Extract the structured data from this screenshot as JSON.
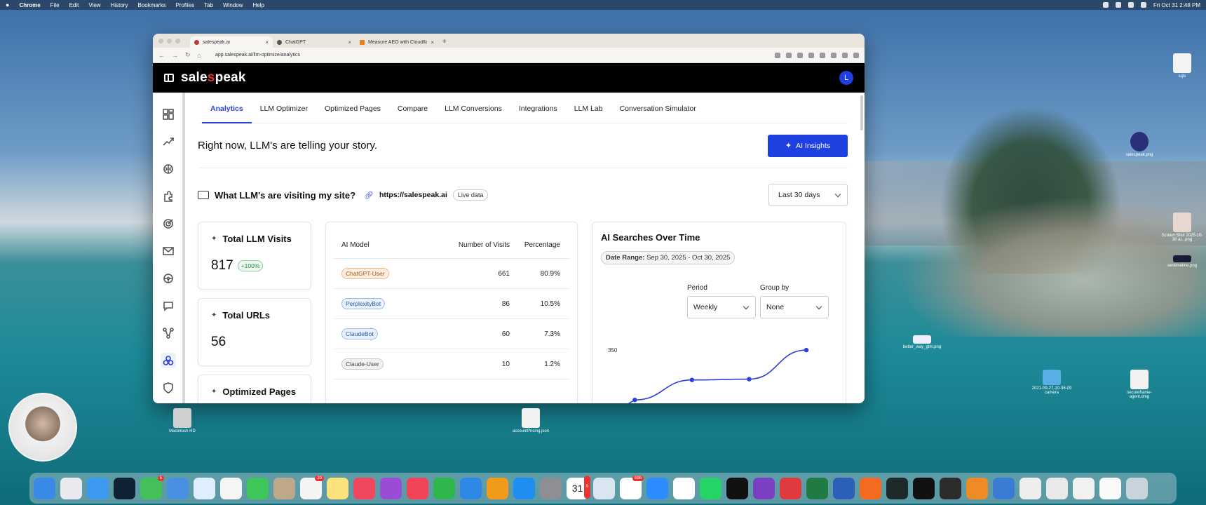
{
  "menubar": {
    "app": "Chrome",
    "items": [
      "File",
      "Edit",
      "View",
      "History",
      "Bookmarks",
      "Profiles",
      "Tab",
      "Window",
      "Help"
    ],
    "clock": "Fri Oct 31  2:48 PM"
  },
  "browser": {
    "tabs": [
      {
        "label": "salespeak.ai",
        "active": true
      },
      {
        "label": "ChatGPT",
        "active": false
      },
      {
        "label": "Measure AEO with Cloudfla…",
        "active": false
      }
    ],
    "url": "app.salespeak.ai/llm-optimize/analytics"
  },
  "app": {
    "logo_prefix": "sale",
    "logo_dot": "s",
    "logo_suffix": "peak",
    "avatar_letter": "L",
    "nav_icons": [
      "dashboard-icon",
      "trend-icon",
      "brain-icon",
      "puzzle-icon",
      "target-icon",
      "mail-icon",
      "steering-icon",
      "chat-icon",
      "network-icon",
      "llm-icon",
      "shield-icon"
    ],
    "tabs": [
      "Analytics",
      "LLM Optimizer",
      "Optimized Pages",
      "Compare",
      "LLM Conversions",
      "Integrations",
      "LLM Lab",
      "Conversation Simulator"
    ],
    "active_tab": "Analytics",
    "hero_title": "Right now, LLM's are telling your story.",
    "ai_insights_label": "AI Insights",
    "visit_question": "What LLM's are visiting my site?",
    "site_url": "https://salespeak.ai",
    "live_badge": "Live data",
    "date_range_select": "Last 30 days",
    "stats": [
      {
        "title": "Total LLM Visits",
        "value": "817",
        "badge": "+100%"
      },
      {
        "title": "Total URLs",
        "value": "56",
        "badge": ""
      },
      {
        "title": "Optimized Pages",
        "value": "",
        "badge": ""
      }
    ],
    "table": {
      "headers": [
        "AI Model",
        "Number of Visits",
        "Percentage"
      ],
      "rows": [
        {
          "model": "ChatGPT-User",
          "visits": "661",
          "pct": "80.9%",
          "color": "orange"
        },
        {
          "model": "PerplexityBot",
          "visits": "86",
          "pct": "10.5%",
          "color": "blue"
        },
        {
          "model": "ClaudeBot",
          "visits": "60",
          "pct": "7.3%",
          "color": "blue"
        },
        {
          "model": "Claude-User",
          "visits": "10",
          "pct": "1.2%",
          "color": "gray"
        }
      ]
    },
    "chart_card": {
      "title": "AI Searches Over Time",
      "date_range_label": "Date Range:",
      "date_range_value": "Sep 30, 2025 - Oct 30, 2025",
      "period_label": "Period",
      "period_value": "Weekly",
      "group_label": "Group by",
      "group_value": "None"
    }
  },
  "chart_data": {
    "type": "line",
    "x": [
      1,
      2,
      3,
      4
    ],
    "values": [
      50,
      170,
      175,
      350
    ],
    "y_ticks": [
      "350"
    ],
    "ylim": [
      0,
      380
    ],
    "grid": false,
    "line_color": "#2c3fd8"
  },
  "desktop": {
    "icons": [
      "sqls",
      "salespeak.png",
      "Screen Shot 2025-10-30 at...png",
      "sentimeline.png",
      "better_way_gtm.png",
      "2021-09-27-10-36-09 camera",
      "secureframe-agent.dmg",
      "Macintosh HD",
      "accountPricing.json"
    ]
  },
  "dock_badges": {
    "messages": "5",
    "reminders": "20",
    "calendar": "9",
    "slack": "696"
  },
  "calendar_day": "31"
}
